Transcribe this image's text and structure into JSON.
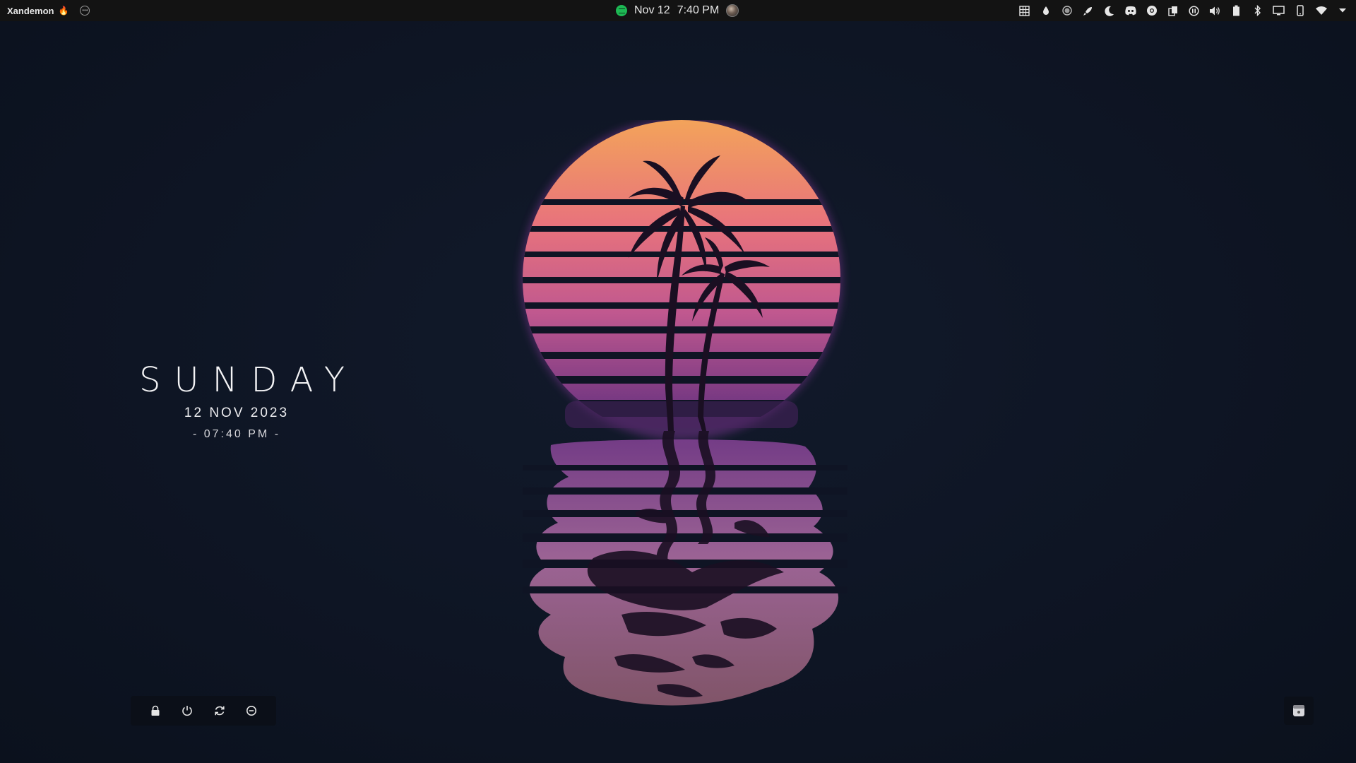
{
  "panel": {
    "user": "Xandemon",
    "date": "Nov 12",
    "time": "7:40 PM",
    "tray_icons": [
      "table-icon",
      "drop-icon",
      "record-icon",
      "rocket-icon",
      "moon-icon",
      "discord-icon",
      "chrome-icon",
      "clipboard-icon",
      "pause-icon",
      "volume-icon",
      "battery-icon",
      "bluetooth-icon",
      "display-icon",
      "phone-icon",
      "wifi-icon",
      "dropdown-icon"
    ]
  },
  "widget": {
    "day": "SUNDAY",
    "date": "12 NOV 2023",
    "time": "- 07:40 PM -"
  },
  "power": {
    "buttons": [
      "lock-icon",
      "power-icon",
      "restart-icon",
      "logout-icon"
    ]
  },
  "colors": {
    "background": "#0d1321",
    "panel": "#131313",
    "sun_top": "#f29a5c",
    "sun_mid": "#e06b86",
    "sun_bottom": "#8a3e9a",
    "silhouette": "#1a0f22",
    "accent_green": "#1db954"
  }
}
